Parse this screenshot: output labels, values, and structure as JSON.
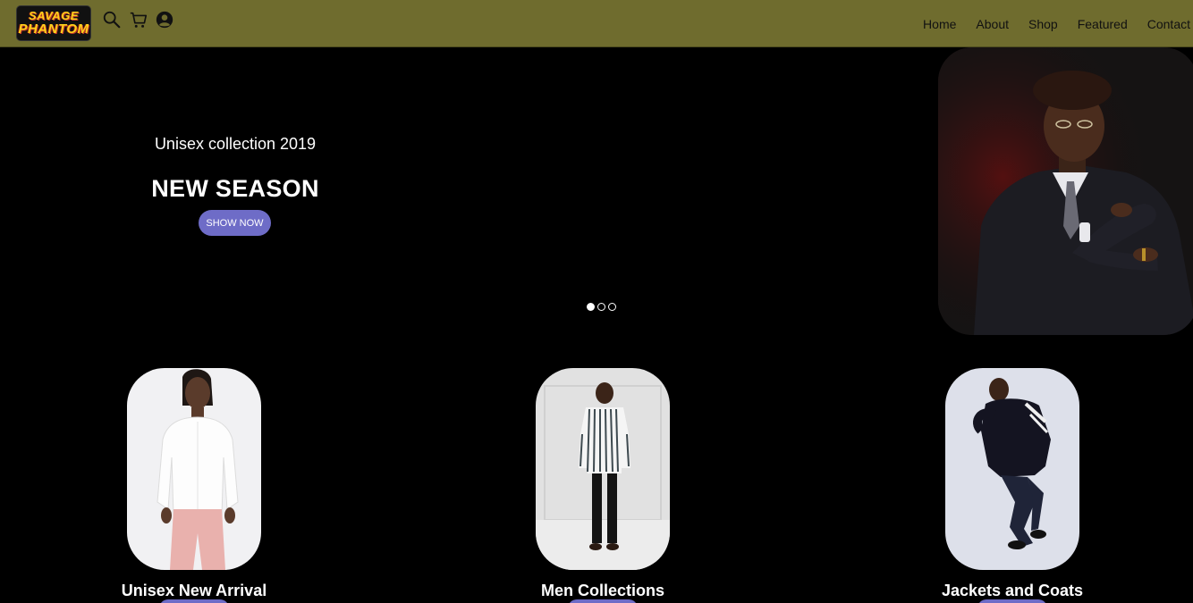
{
  "header": {
    "logo_top": "Savage",
    "logo_bottom": "Phantom",
    "bg_color": "#6f6c2e",
    "icons": [
      "search-icon",
      "cart-icon",
      "user-icon"
    ],
    "nav": [
      "Home",
      "About",
      "Shop",
      "Featured",
      "Contact"
    ]
  },
  "hero": {
    "subtitle": "Unisex collection 2019",
    "title": "NEW SEASON",
    "button": "SHOW NOW",
    "button_color": "#6e6cc7",
    "slides": 3,
    "active_slide": 1
  },
  "categories": [
    {
      "title": "Unisex New Arrival"
    },
    {
      "title": "Men Collections"
    },
    {
      "title": "Jackets and Coats"
    }
  ]
}
